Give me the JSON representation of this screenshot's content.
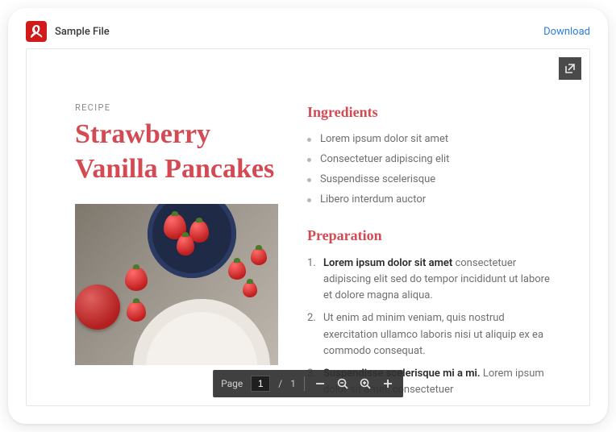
{
  "header": {
    "file_title": "Sample File",
    "download_label": "Download"
  },
  "document": {
    "label": "RECIPE",
    "title": "Strawberry Vanilla Pancakes",
    "ingredients_heading": "Ingredients",
    "ingredients": [
      "Lorem ipsum dolor sit amet",
      "Consectetuer adipiscing elit",
      "Suspendisse scelerisque",
      "Libero interdum auctor"
    ],
    "preparation_heading": "Preparation",
    "preparation": [
      {
        "lead": "Lorem ipsum dolor sit amet",
        "rest": " consectetuer adipiscing elit sed do tempor incididunt ut labore et dolore magna aliqua."
      },
      {
        "lead": "",
        "rest": "Ut enim ad minim veniam, quis nostrud exercitation ullamco laboris nisi ut aliquip ex ea commodo consequat."
      },
      {
        "lead": "Suspendisse scelerisque mi a mi.",
        "rest": " Lorem ipsum dolor sit amet, consectetuer"
      }
    ]
  },
  "toolbar": {
    "page_label": "Page",
    "current_page": "1",
    "total_pages": "1"
  },
  "icons": {
    "pdf": "pdf-icon",
    "open_external": "open-external-icon",
    "zoom_out": "zoom-out-icon",
    "zoom_in": "zoom-in-icon",
    "minus": "minus-icon",
    "plus": "plus-icon"
  },
  "colors": {
    "accent": "#d44a53",
    "link": "#2a7de1",
    "pdf_red": "#d11b1b",
    "toolbar_bg": "rgba(48,48,48,0.92)"
  }
}
